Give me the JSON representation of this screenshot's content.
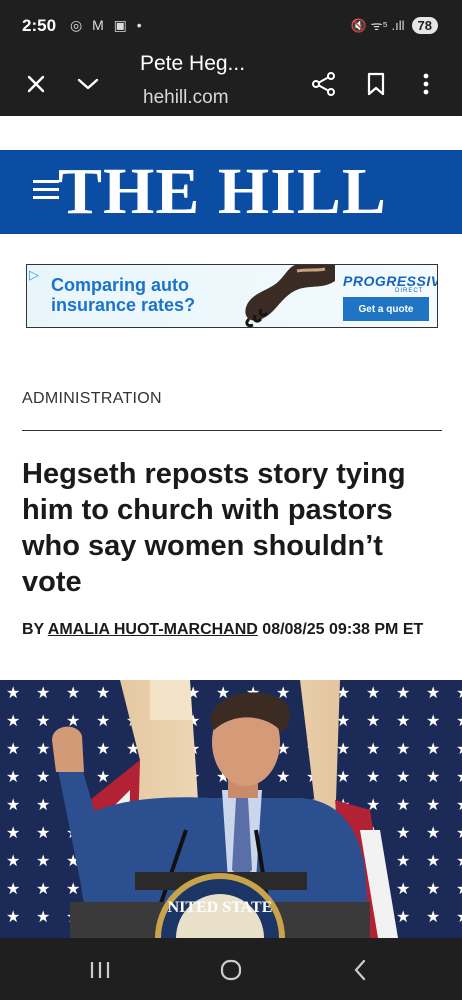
{
  "status_bar": {
    "time": "2:50",
    "notifications": "◎ M ▣ •",
    "signal": "🔇 ᯤ⁵ .ıll",
    "battery": "78"
  },
  "browser_toolbar": {
    "page_title": "Pete Heg...",
    "url": "hehill.com",
    "icons": [
      "close-icon",
      "chevron-down-icon",
      "share-icon",
      "bookmark-icon",
      "more-vert-icon"
    ]
  },
  "masthead": {
    "logo_text": "THE HILL",
    "menu_icon": "hamburger-icon",
    "background": "#0b4da2"
  },
  "ad": {
    "headline": "Comparing auto insurance rates?",
    "brand": "PROGRESSIVE",
    "brand_sub": "DIRECT",
    "cta": "Get a quote"
  },
  "article": {
    "section": "ADMINISTRATION",
    "headline": "Hegseth reposts story tying him to church with pastors who say women shouldn’t vote",
    "byline_prefix": "BY ",
    "author": "AMALIA HUOT-MARCHAND",
    "timestamp": " 08/08/25 09:38 PM ET"
  },
  "hero_image": {
    "seal_text": "NITED STATE"
  },
  "nav_bar": {
    "icons": [
      "recent-apps-icon",
      "home-icon",
      "back-icon"
    ]
  },
  "colors": {
    "brand_blue": "#0b4da2",
    "dark_chrome": "#1f1f1f",
    "ad_blue": "#1b74c9"
  }
}
